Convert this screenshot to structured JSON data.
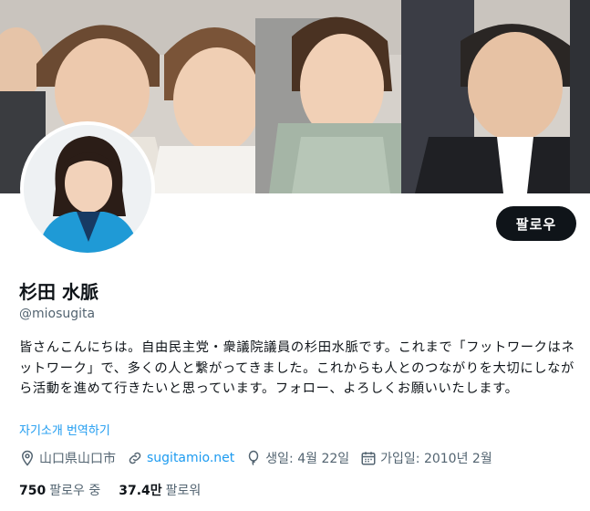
{
  "header": {
    "banner_alt": "",
    "follow_label": "팔로우"
  },
  "profile": {
    "name": "杉田 水脈",
    "handle": "@miosugita",
    "bio": "皆さんこんにちは。自由民主党・衆議院議員の杉田水脈です。これまで「フットワークはネットワーク」で、多くの人と繋がってきました。これからも人とのつながりを大切にしながら活動を進めて行きたいと思っています。フォロー、よろしくお願いいたします。",
    "translate_label": "자기소개 번역하기"
  },
  "meta": {
    "location": "山口県山口市",
    "website": "sugitamio.net",
    "birthday": "생일: 4월 22일",
    "joined": "가입일: 2010년 2월"
  },
  "counts": {
    "following_num": "750",
    "following_label": "팔로우 중",
    "followers_num": "37.4만",
    "followers_label": "팔로워"
  },
  "icons": {
    "location": "location-pin-icon",
    "link": "link-icon",
    "birthday": "balloon-icon",
    "joined": "calendar-icon"
  },
  "colors": {
    "accent": "#1d9bf0",
    "text": "#0f1419",
    "secondary": "#536471",
    "button_bg": "#0f1419"
  }
}
